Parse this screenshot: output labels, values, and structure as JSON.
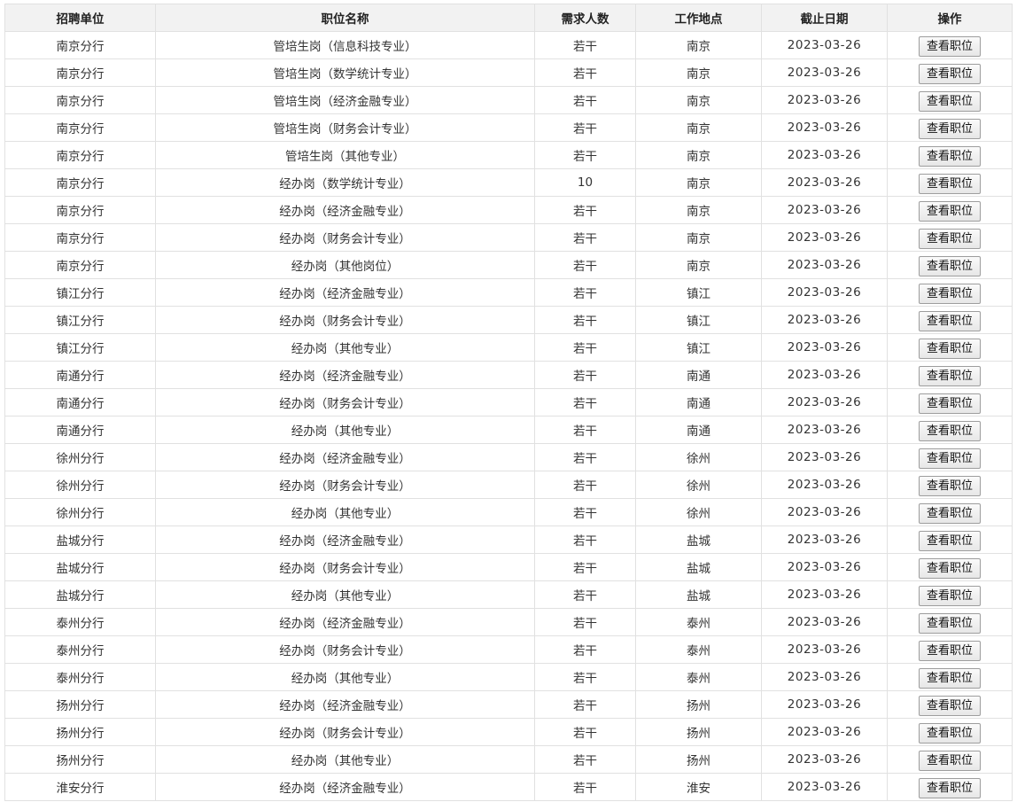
{
  "headers": {
    "unit": "招聘单位",
    "position": "职位名称",
    "count": "需求人数",
    "location": "工作地点",
    "deadline": "截止日期",
    "action": "操作"
  },
  "rows": [
    {
      "unit": "南京分行",
      "position": "管培生岗（信息科技专业）",
      "count": "若干",
      "location": "南京",
      "deadline": "2023-03-26",
      "action": "查看职位"
    },
    {
      "unit": "南京分行",
      "position": "管培生岗（数学统计专业）",
      "count": "若干",
      "location": "南京",
      "deadline": "2023-03-26",
      "action": "查看职位"
    },
    {
      "unit": "南京分行",
      "position": "管培生岗（经济金融专业）",
      "count": "若干",
      "location": "南京",
      "deadline": "2023-03-26",
      "action": "查看职位"
    },
    {
      "unit": "南京分行",
      "position": "管培生岗（财务会计专业）",
      "count": "若干",
      "location": "南京",
      "deadline": "2023-03-26",
      "action": "查看职位"
    },
    {
      "unit": "南京分行",
      "position": "管培生岗（其他专业）",
      "count": "若干",
      "location": "南京",
      "deadline": "2023-03-26",
      "action": "查看职位"
    },
    {
      "unit": "南京分行",
      "position": "经办岗（数学统计专业）",
      "count": "10",
      "location": "南京",
      "deadline": "2023-03-26",
      "action": "查看职位"
    },
    {
      "unit": "南京分行",
      "position": "经办岗（经济金融专业）",
      "count": "若干",
      "location": "南京",
      "deadline": "2023-03-26",
      "action": "查看职位"
    },
    {
      "unit": "南京分行",
      "position": "经办岗（财务会计专业）",
      "count": "若干",
      "location": "南京",
      "deadline": "2023-03-26",
      "action": "查看职位"
    },
    {
      "unit": "南京分行",
      "position": "经办岗（其他岗位）",
      "count": "若干",
      "location": "南京",
      "deadline": "2023-03-26",
      "action": "查看职位"
    },
    {
      "unit": "镇江分行",
      "position": "经办岗（经济金融专业）",
      "count": "若干",
      "location": "镇江",
      "deadline": "2023-03-26",
      "action": "查看职位"
    },
    {
      "unit": "镇江分行",
      "position": "经办岗（财务会计专业）",
      "count": "若干",
      "location": "镇江",
      "deadline": "2023-03-26",
      "action": "查看职位"
    },
    {
      "unit": "镇江分行",
      "position": "经办岗（其他专业）",
      "count": "若干",
      "location": "镇江",
      "deadline": "2023-03-26",
      "action": "查看职位"
    },
    {
      "unit": "南通分行",
      "position": "经办岗（经济金融专业）",
      "count": "若干",
      "location": "南通",
      "deadline": "2023-03-26",
      "action": "查看职位"
    },
    {
      "unit": "南通分行",
      "position": "经办岗（财务会计专业）",
      "count": "若干",
      "location": "南通",
      "deadline": "2023-03-26",
      "action": "查看职位"
    },
    {
      "unit": "南通分行",
      "position": "经办岗（其他专业）",
      "count": "若干",
      "location": "南通",
      "deadline": "2023-03-26",
      "action": "查看职位"
    },
    {
      "unit": "徐州分行",
      "position": "经办岗（经济金融专业）",
      "count": "若干",
      "location": "徐州",
      "deadline": "2023-03-26",
      "action": "查看职位"
    },
    {
      "unit": "徐州分行",
      "position": "经办岗（财务会计专业）",
      "count": "若干",
      "location": "徐州",
      "deadline": "2023-03-26",
      "action": "查看职位"
    },
    {
      "unit": "徐州分行",
      "position": "经办岗（其他专业）",
      "count": "若干",
      "location": "徐州",
      "deadline": "2023-03-26",
      "action": "查看职位"
    },
    {
      "unit": "盐城分行",
      "position": "经办岗（经济金融专业）",
      "count": "若干",
      "location": "盐城",
      "deadline": "2023-03-26",
      "action": "查看职位"
    },
    {
      "unit": "盐城分行",
      "position": "经办岗（财务会计专业）",
      "count": "若干",
      "location": "盐城",
      "deadline": "2023-03-26",
      "action": "查看职位"
    },
    {
      "unit": "盐城分行",
      "position": "经办岗（其他专业）",
      "count": "若干",
      "location": "盐城",
      "deadline": "2023-03-26",
      "action": "查看职位"
    },
    {
      "unit": "泰州分行",
      "position": "经办岗（经济金融专业）",
      "count": "若干",
      "location": "泰州",
      "deadline": "2023-03-26",
      "action": "查看职位"
    },
    {
      "unit": "泰州分行",
      "position": "经办岗（财务会计专业）",
      "count": "若干",
      "location": "泰州",
      "deadline": "2023-03-26",
      "action": "查看职位"
    },
    {
      "unit": "泰州分行",
      "position": "经办岗（其他专业）",
      "count": "若干",
      "location": "泰州",
      "deadline": "2023-03-26",
      "action": "查看职位"
    },
    {
      "unit": "扬州分行",
      "position": "经办岗（经济金融专业）",
      "count": "若干",
      "location": "扬州",
      "deadline": "2023-03-26",
      "action": "查看职位"
    },
    {
      "unit": "扬州分行",
      "position": "经办岗（财务会计专业）",
      "count": "若干",
      "location": "扬州",
      "deadline": "2023-03-26",
      "action": "查看职位"
    },
    {
      "unit": "扬州分行",
      "position": "经办岗（其他专业）",
      "count": "若干",
      "location": "扬州",
      "deadline": "2023-03-26",
      "action": "查看职位"
    },
    {
      "unit": "淮安分行",
      "position": "经办岗（经济金融专业）",
      "count": "若干",
      "location": "淮安",
      "deadline": "2023-03-26",
      "action": "查看职位"
    }
  ]
}
